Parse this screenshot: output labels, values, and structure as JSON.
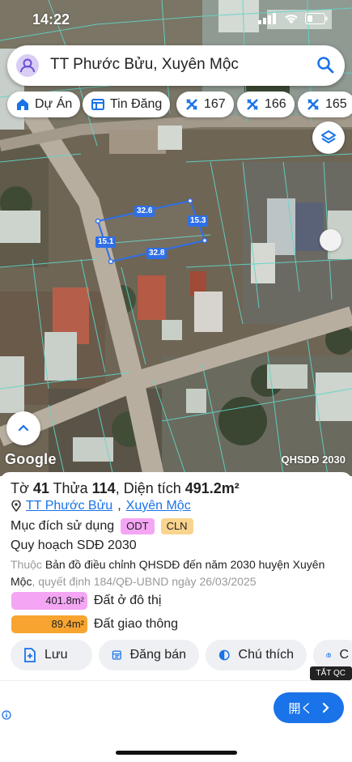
{
  "status": {
    "time": "14:22"
  },
  "search": {
    "query": "TT Phước Bửu, Xuyên Mộc"
  },
  "chips": [
    {
      "label": "Dự Án",
      "icon": "house-icon"
    },
    {
      "label": "Tin Đăng",
      "icon": "listing-icon"
    },
    {
      "label": "167",
      "icon": "road-icon"
    },
    {
      "label": "166",
      "icon": "road-icon"
    },
    {
      "label": "165",
      "icon": "road-icon"
    }
  ],
  "map": {
    "dimensions": [
      "32.6",
      "15.3",
      "15.1",
      "32.8"
    ],
    "google_label": "Google",
    "layer_label": "QHSDĐ 2030"
  },
  "parcel": {
    "title_prefix": "Tờ",
    "sheet": "41",
    "parcel_prefix": "Thửa",
    "parcel": "114",
    "area_prefix": ", Diện tích",
    "area": "491.2m²",
    "ward": "TT Phước Bửu",
    "district": "Xuyên Mộc",
    "purpose_label": "Mục đích sử dụng",
    "purpose_tags": [
      "ODT",
      "CLN"
    ],
    "plan_title": "Quy hoạch SDĐ 2030",
    "desc_prefix": "Thuộc",
    "desc_map": "Bản đồ điều chỉnh QHSDĐ đến năm 2030 huyện Xuyên Mộc",
    "desc_decision": ", quyết định 184/QĐ-UBND ngày 26/03/2025",
    "land_uses": [
      {
        "area": "401.8m²",
        "label": "Đất ở đô thị",
        "color": "#f4a6f4"
      },
      {
        "area": "89.4m²",
        "label": "Đất giao thông",
        "color": "#f7a530"
      }
    ]
  },
  "actions": [
    {
      "label": "Lưu",
      "icon": "save-icon"
    },
    {
      "label": "Đăng bán",
      "icon": "post-icon"
    },
    {
      "label": "Chú thích",
      "icon": "legend-icon"
    },
    {
      "label": "C",
      "icon": "camera-icon"
    }
  ],
  "ad": {
    "hide_label": "TẮT QC",
    "button_label": "開く"
  }
}
